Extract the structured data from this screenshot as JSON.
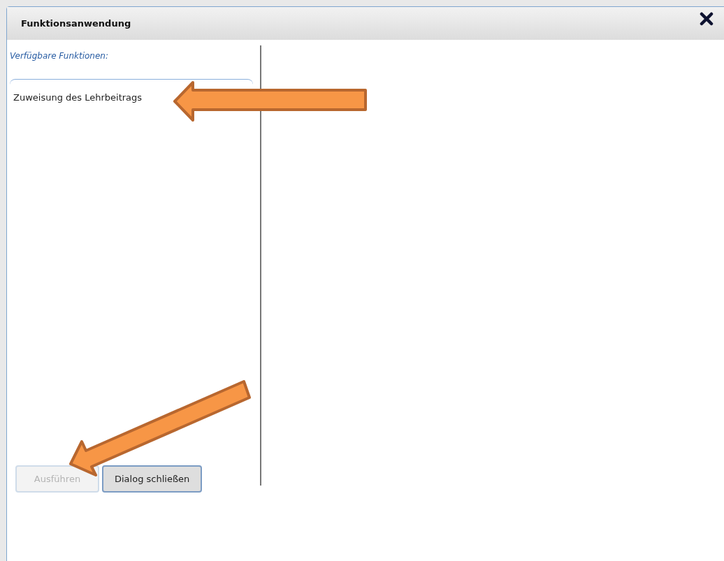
{
  "dialog": {
    "title": "Funktionsanwendung"
  },
  "functions": {
    "label": "Verfügbare Funktionen:",
    "items": [
      {
        "label": "Zuweisung des Lehrbeitrags",
        "selected": false
      }
    ]
  },
  "buttons": [
    {
      "label": "Ausführen",
      "disabled": true
    },
    {
      "label": "Dialog schließen",
      "disabled": false
    }
  ]
}
